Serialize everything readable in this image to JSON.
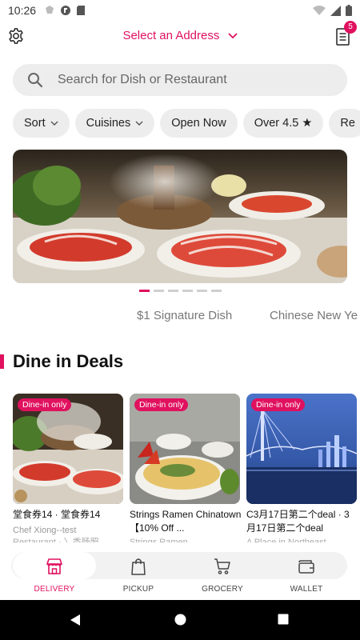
{
  "status_bar": {
    "time": "10:26"
  },
  "header": {
    "address_label": "Select an Address",
    "orders_badge": "5"
  },
  "search": {
    "placeholder": "Search for Dish or Restaurant"
  },
  "filters": [
    {
      "label": "Sort",
      "has_caret": true
    },
    {
      "label": "Cuisines",
      "has_caret": true
    },
    {
      "label": "Open Now",
      "has_caret": false
    },
    {
      "label": "Over 4.5 ★",
      "has_caret": false
    },
    {
      "label": "Re",
      "has_caret": false
    }
  ],
  "carousel": {
    "slide_count": 6,
    "active_index": 0,
    "labels": [
      "$1 Signature Dish",
      "Chinese New Ye"
    ]
  },
  "section": {
    "title": "Dine in Deals"
  },
  "deals": [
    {
      "tag": "Dine-in only",
      "name": "堂食券14 · 堂食券14",
      "subtitle": "Chef Xiong--test",
      "subtitle2": "Restaurant · 〉香肠照"
    },
    {
      "tag": "Dine-in only",
      "name": "Strings Ramen Chinatown 【10% Off ...",
      "subtitle": "Strings Ramen",
      "subtitle2": ""
    },
    {
      "tag": "Dine-in only",
      "name": "C3月17日第二个deal · 3月17日第二个deal",
      "subtitle": "A Place in Northeast",
      "subtitle2": ""
    }
  ],
  "tabs": [
    {
      "label": "DELIVERY",
      "icon": "storefront-icon",
      "active": true
    },
    {
      "label": "PICKUP",
      "icon": "shopping-bag-icon",
      "active": false
    },
    {
      "label": "GROCERY",
      "icon": "cart-icon",
      "active": false
    },
    {
      "label": "WALLET",
      "icon": "wallet-icon",
      "active": false
    }
  ],
  "colors": {
    "accent": "#e0115f",
    "chip_bg": "#ededed"
  }
}
